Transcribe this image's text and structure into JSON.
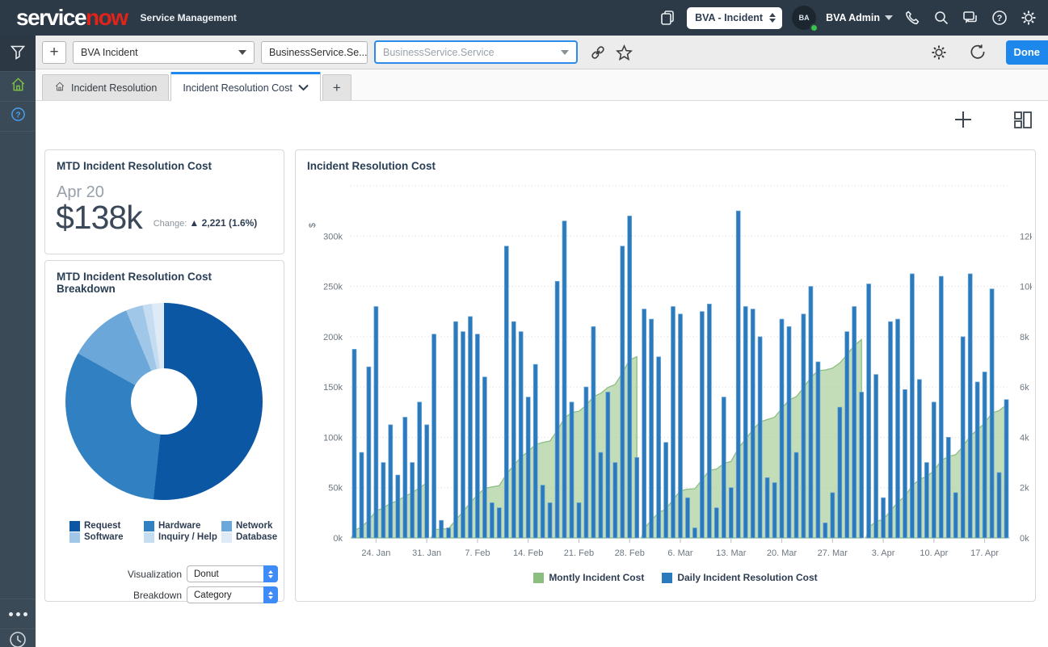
{
  "header": {
    "logo_part1": "service",
    "logo_part2": "now",
    "product_name": "Service Management",
    "app_picker_value": "BVA - Incident",
    "user_initials": "BA",
    "user_name": "BVA Admin"
  },
  "toolbar": {
    "add_label": "+",
    "dashboard_dropdown_value": "BVA Incident",
    "breakdown_dropdown_value": "BusinessService.Se...",
    "filter_placeholder": "BusinessService.Service",
    "done_label": "Done"
  },
  "tab_bar": {
    "tabs": [
      {
        "label": "Incident Resolution"
      },
      {
        "label": "Incident Resolution Cost"
      }
    ],
    "add_tab_label": "+"
  },
  "mtd_card": {
    "title": "MTD Incident Resolution Cost",
    "date": "Apr 20",
    "value": "$138k",
    "change_label": "Change:",
    "change_value": "▲ 2,221 (1.6%)"
  },
  "breakdown_card": {
    "title": "MTD Incident Resolution Cost Breakdown",
    "visualization_label": "Visualization",
    "visualization_value": "Donut",
    "breakdown_label": "Breakdown",
    "breakdown_value": "Category"
  },
  "chart_card": {
    "title": "Incident Resolution Cost"
  },
  "chart_data": [
    {
      "type": "pie",
      "variant": "donut",
      "title": "MTD Incident Resolution Cost Breakdown",
      "labels": [
        "Request",
        "Hardware",
        "Network",
        "Software",
        "Inquiry / Help",
        "Database"
      ],
      "values_percent": [
        51.7,
        31.4,
        10.6,
        2.8,
        1.5,
        2.0
      ],
      "colors": [
        "#0b57a4",
        "#3180c1",
        "#6ba7d8",
        "#a0c7e8",
        "#c6dcf0",
        "#dfeaf7"
      ],
      "legend_position": "bottom",
      "controls": {
        "visualization": "Donut",
        "breakdown": "Category"
      }
    },
    {
      "type": "bar",
      "subtype": "combo-bar-area",
      "title": "Incident Resolution Cost",
      "ylabel_left": "$",
      "axis_left": {
        "min": 0,
        "max": 350,
        "tick_step": 50,
        "tick_labels": [
          "0k",
          "50k",
          "100k",
          "150k",
          "200k",
          "250k",
          "300k"
        ]
      },
      "axis_right": {
        "min": 0,
        "max": 14,
        "tick_step": 2,
        "tick_labels": [
          "0k",
          "2k",
          "4k",
          "6k",
          "8k",
          "10k",
          "12k"
        ]
      },
      "grid": "dotted-horizontal",
      "start_date": "21. Jan",
      "end_date": "20. Apr",
      "month_lengths": [
        11,
        29,
        31,
        20
      ],
      "x_tick_labels": [
        "24. Jan",
        "31. Jan",
        "7. Feb",
        "14. Feb",
        "21. Feb",
        "28. Feb",
        "6. Mar",
        "13. Mar",
        "20. Mar",
        "27. Mar",
        "3. Apr",
        "10. Apr",
        "17. Apr"
      ],
      "x_tick_indices": [
        3,
        10,
        17,
        24,
        31,
        38,
        45,
        52,
        59,
        66,
        73,
        80,
        87
      ],
      "legend_position": "bottom",
      "series": [
        {
          "name": "Montly Incident Cost",
          "type": "area",
          "axis": "left",
          "color": "#8cbe7f",
          "fill": "#9cc78b",
          "note": "month-to-date cumulative of daily cost, resets each month, $k (estimated)"
        },
        {
          "name": "Daily Incident Resolution Cost",
          "type": "bar",
          "axis": "right",
          "color": "#2b7abd",
          "values_k_estimated": [
            7.5,
            3.4,
            6.8,
            9.2,
            3.0,
            4.5,
            2.5,
            4.8,
            3.0,
            5.4,
            4.5,
            8.1,
            0.7,
            0.4,
            8.6,
            8.2,
            8.8,
            8.1,
            6.4,
            1.4,
            1.2,
            11.6,
            8.6,
            8.2,
            5.6,
            6.9,
            2.1,
            1.4,
            10.2,
            12.6,
            5.4,
            1.4,
            6.0,
            8.4,
            3.4,
            5.8,
            3.0,
            11.6,
            12.8,
            3.2,
            9.1,
            8.7,
            7.2,
            3.8,
            9.2,
            8.9,
            1.6,
            0.4,
            9.0,
            9.3,
            1.2,
            5.6,
            2.0,
            13.0,
            9.2,
            9.1,
            8.0,
            2.4,
            2.2,
            8.7,
            8.4,
            3.4,
            8.9,
            10.0,
            7.0,
            0.6,
            1.8,
            5.2,
            8.2,
            9.2,
            5.8,
            10.1,
            6.5,
            1.6,
            8.6,
            8.7,
            5.9,
            10.5,
            6.3,
            3.0,
            5.4,
            10.4,
            4.0,
            1.8,
            8.0,
            10.5,
            6.2,
            6.6,
            9.9,
            2.6,
            5.5
          ]
        }
      ]
    }
  ]
}
